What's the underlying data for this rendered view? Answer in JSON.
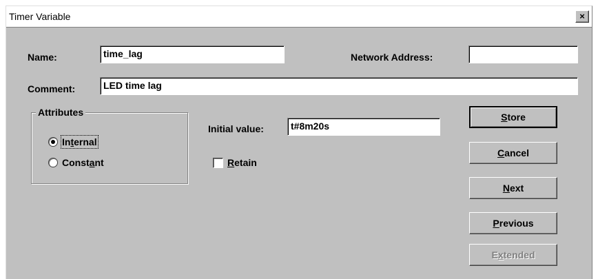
{
  "window": {
    "title": "Timer Variable",
    "close_glyph": "×"
  },
  "labels": {
    "name": "Name:",
    "network_address": "Network Address:",
    "comment": "Comment:",
    "initial_value": "Initial value:"
  },
  "fields": {
    "name": "time_lag",
    "network_address": "",
    "comment": "LED time lag",
    "initial_value": "t#8m20s"
  },
  "attributes": {
    "title": "Attributes",
    "internal": {
      "pre": "In",
      "key": "t",
      "post": "ernal",
      "checked": true
    },
    "constant": {
      "pre": "Const",
      "key": "a",
      "post": "nt",
      "checked": false
    }
  },
  "retain": {
    "pre": "",
    "key": "R",
    "post": "etain",
    "checked": false
  },
  "buttons": {
    "store": {
      "key": "S",
      "post": "tore"
    },
    "cancel": {
      "key": "C",
      "post": "ancel"
    },
    "next": {
      "key": "N",
      "post": "ext"
    },
    "previous": {
      "key": "P",
      "post": "revious"
    },
    "extended": {
      "pre": "E",
      "key": "x",
      "post": "tended",
      "disabled": true
    }
  }
}
